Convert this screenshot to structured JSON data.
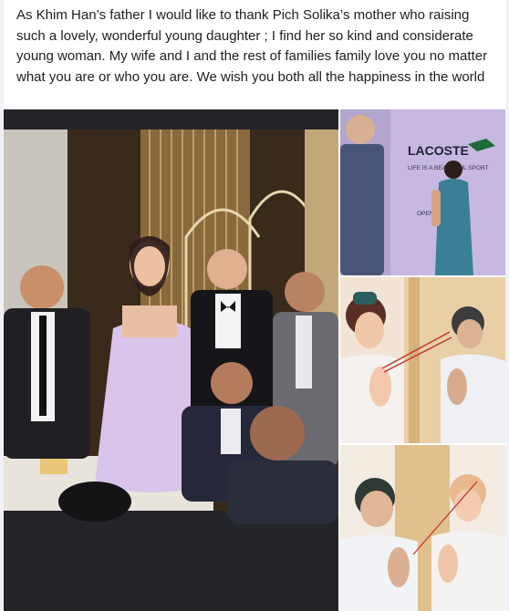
{
  "post": {
    "text": "As Khim Han’s father I would like to thank Pich Solika’s mother who raising such a lovely, wonderful young daughter ; I find her so kind and considerate young woman. My wife and I and the rest of families family love you no matter what you are or who you are. We wish you both all the happiness in the world"
  },
  "photos": {
    "main": {
      "icon": "wedding-party-photo"
    },
    "second": {
      "icon": "lacoste-event-photo",
      "logo_text": "LACOSTE",
      "tagline": "LIFE IS A BEAUTIFUL SPORT",
      "open_text": "OPEN"
    },
    "third": {
      "icon": "praying-couple-photo"
    },
    "fourth": {
      "icon": "praying-couple-photo"
    }
  },
  "colors": {
    "background": "#f0f2f5",
    "card": "#ffffff",
    "text": "#1c1e21",
    "lacoste_purple": "#b7a5d6"
  }
}
